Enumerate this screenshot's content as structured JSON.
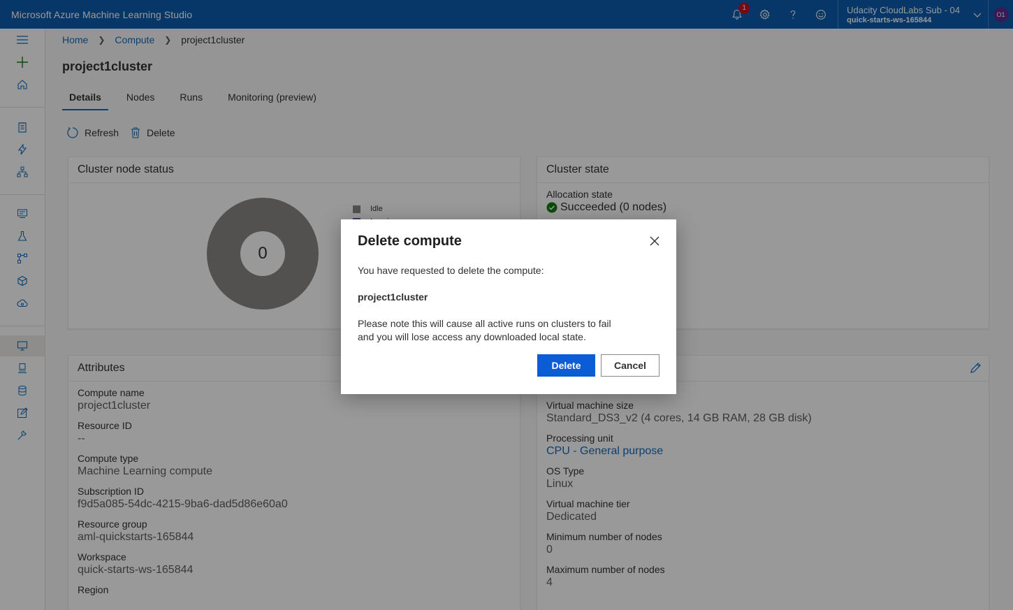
{
  "app": {
    "title": "Microsoft Azure Machine Learning Studio"
  },
  "topbar": {
    "notification_count": "1",
    "account_sub": "Udacity CloudLabs Sub - 04",
    "account_ws": "quick-starts-ws-165844",
    "avatar_initials": "O1"
  },
  "breadcrumb": {
    "home": "Home",
    "compute": "Compute",
    "current": "project1cluster"
  },
  "page": {
    "title": "project1cluster"
  },
  "tabs": [
    "Details",
    "Nodes",
    "Runs",
    "Monitoring (preview)"
  ],
  "toolbar": {
    "refresh": "Refresh",
    "delete": "Delete"
  },
  "node_status": {
    "title": "Cluster node status",
    "total": "0",
    "legend": [
      {
        "label": "Idle",
        "color": "#8a8886"
      },
      {
        "label": "Leaving",
        "color": "#6b5ea8"
      }
    ]
  },
  "cluster_state": {
    "title": "Cluster state",
    "allocation_label": "Allocation state",
    "allocation_value": "Succeeded (0 nodes)"
  },
  "attributes": {
    "title": "Attributes",
    "compute_name_label": "Compute name",
    "compute_name": "project1cluster",
    "resource_id_label": "Resource ID",
    "resource_id": "--",
    "compute_type_label": "Compute type",
    "compute_type": "Machine Learning compute",
    "subscription_label": "Subscription ID",
    "subscription": "f9d5a085-54dc-4215-9ba6-dad5d86e60a0",
    "resource_group_label": "Resource group",
    "resource_group": "aml-quickstarts-165844",
    "workspace_label": "Workspace",
    "workspace": "quick-starts-ws-165844",
    "region_label": "Region"
  },
  "properties": {
    "vm_size_label": "Virtual machine size",
    "vm_size": "Standard_DS3_v2 (4 cores, 14 GB RAM, 28 GB disk)",
    "processing_unit_label": "Processing unit",
    "processing_unit": "CPU - General purpose",
    "os_label": "OS Type",
    "os": "Linux",
    "tier_label": "Virtual machine tier",
    "tier": "Dedicated",
    "min_nodes_label": "Minimum number of nodes",
    "min_nodes": "0",
    "max_nodes_label": "Maximum number of nodes",
    "max_nodes": "4"
  },
  "dialog": {
    "title": "Delete compute",
    "message": "You have requested to delete the compute:",
    "compute_name": "project1cluster",
    "note_line1": "Please note this will cause all active runs on clusters to fail",
    "note_line2": "and you will lose access any downloaded local state.",
    "delete_label": "Delete",
    "cancel_label": "Cancel"
  }
}
